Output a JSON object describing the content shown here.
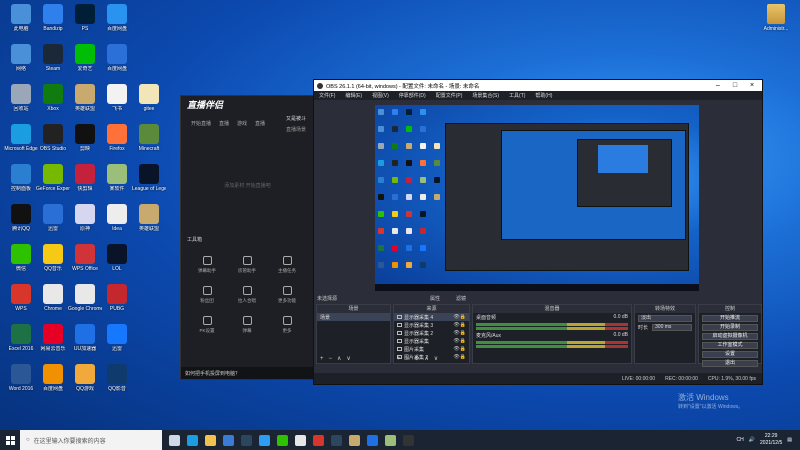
{
  "desktop": {
    "icons": [
      {
        "label": "此电脑",
        "color": "#4a90d9",
        "col": 0,
        "row": 0
      },
      {
        "label": "网络",
        "color": "#4a90d9",
        "col": 0,
        "row": 1
      },
      {
        "label": "回收站",
        "color": "#9aa7b8",
        "col": 0,
        "row": 2
      },
      {
        "label": "Microsoft Edge",
        "color": "#1b9de2",
        "col": 0,
        "row": 3
      },
      {
        "label": "控制面板",
        "color": "#2a7fd1",
        "col": 0,
        "row": 4
      },
      {
        "label": "腾讯QQ",
        "color": "#111111",
        "col": 0,
        "row": 5
      },
      {
        "label": "微信",
        "color": "#2dc100",
        "col": 0,
        "row": 6
      },
      {
        "label": "WPS",
        "color": "#d9362b",
        "col": 0,
        "row": 7
      },
      {
        "label": "Excel 2016",
        "color": "#1e7145",
        "col": 0,
        "row": 8
      },
      {
        "label": "Word 2016",
        "color": "#2b5797",
        "col": 0,
        "row": 9
      },
      {
        "label": "Bandizip",
        "color": "#2f80ed",
        "col": 1,
        "row": 0
      },
      {
        "label": "Steam",
        "color": "#1b2838",
        "col": 1,
        "row": 1
      },
      {
        "label": "Xbox",
        "color": "#107c10",
        "col": 1,
        "row": 2
      },
      {
        "label": "OBS Studio",
        "color": "#222222",
        "col": 1,
        "row": 3
      },
      {
        "label": "GeForce Experience",
        "color": "#76b900",
        "col": 1,
        "row": 4
      },
      {
        "label": "迅雷",
        "color": "#2a6fd6",
        "col": 1,
        "row": 5
      },
      {
        "label": "QQ音乐",
        "color": "#f6c915",
        "col": 1,
        "row": 6
      },
      {
        "label": "Chrome",
        "color": "#e8e8e8",
        "col": 1,
        "row": 7
      },
      {
        "label": "网易云音乐",
        "color": "#e60026",
        "col": 1,
        "row": 8
      },
      {
        "label": "百度网盘",
        "color": "#f29100",
        "col": 1,
        "row": 9
      },
      {
        "label": "PS",
        "color": "#001e36",
        "col": 2,
        "row": 0
      },
      {
        "label": "爱奇艺",
        "color": "#00be06",
        "col": 2,
        "row": 1
      },
      {
        "label": "英雄联盟",
        "color": "#c8aa6e",
        "col": 2,
        "row": 2
      },
      {
        "label": "剪映",
        "color": "#111111",
        "col": 2,
        "row": 3
      },
      {
        "label": "快剪辑",
        "color": "#c4213c",
        "col": 2,
        "row": 4
      },
      {
        "label": "原神",
        "color": "#d6d6f0",
        "col": 2,
        "row": 5
      },
      {
        "label": "WPS Office",
        "color": "#d13438",
        "col": 2,
        "row": 6
      },
      {
        "label": "Google Chrome",
        "color": "#e8e8e8",
        "col": 2,
        "row": 7
      },
      {
        "label": "UU加速器",
        "color": "#1f6fe5",
        "col": 2,
        "row": 8
      },
      {
        "label": "QQ游戏",
        "color": "#f2a93b",
        "col": 2,
        "row": 9
      },
      {
        "label": "百度网盘",
        "color": "#2a93f0",
        "col": 3,
        "row": 0
      },
      {
        "label": "百度网盘",
        "color": "#2b6fd8",
        "col": 3,
        "row": 1
      },
      {
        "label": "飞书",
        "color": "#f2f2f2",
        "col": 3,
        "row": 2
      },
      {
        "label": "Firefox",
        "color": "#ff7139",
        "col": 3,
        "row": 3
      },
      {
        "label": "某软件",
        "color": "#9bbf7b",
        "col": 3,
        "row": 4
      },
      {
        "label": "Idea",
        "color": "#ededed",
        "col": 3,
        "row": 5
      },
      {
        "label": "LOL",
        "color": "#0a1428",
        "col": 3,
        "row": 6
      },
      {
        "label": "PUBG",
        "color": "#c4272e",
        "col": 3,
        "row": 7
      },
      {
        "label": "迅雷",
        "color": "#1677ff",
        "col": 3,
        "row": 8
      },
      {
        "label": "QQ影音",
        "color": "#0e3a6e",
        "col": 3,
        "row": 9
      },
      {
        "label": "gitee",
        "color": "#f2e6b8",
        "col": 4,
        "row": 2
      },
      {
        "label": "Minecraft",
        "color": "#5a8a3a",
        "col": 4,
        "row": 3
      },
      {
        "label": "League of Legends",
        "color": "#0a1428",
        "col": 4,
        "row": 4
      },
      {
        "label": "英雄联盟",
        "color": "#c8aa6e",
        "col": 4,
        "row": 5
      }
    ],
    "admin_label": "Administr..."
  },
  "zhibo": {
    "logo": "直播伴侣",
    "tabs": [
      "开始直播",
      "直播",
      "游戏",
      "直播"
    ],
    "hint": "添加素材 开始直播吧",
    "tools_label": "工具箱",
    "tools": [
      "弹幕助手",
      "房管助手",
      "主播任务",
      "粉丝团",
      "拉人合唱",
      "更多功能",
      "PK设置",
      "弹幕",
      "更多"
    ],
    "footer": "如何把手机投屏到电脑？",
    "side_text": "又是被斗",
    "side_sub": "直播场景"
  },
  "obs": {
    "title": "OBS 26.1.1 (64-bit, windows) - 配置文件: 未命名 - 场景: 未命名",
    "menu": [
      "文件(F)",
      "编辑(E)",
      "视图(V)",
      "停靠部件(D)",
      "配置文件(P)",
      "场景集合(S)",
      "工具(T)",
      "帮助(H)"
    ],
    "no_source": "未选择源",
    "props": "属性",
    "filters": "滤镜",
    "docks": {
      "scenes": {
        "title": "场景",
        "items": [
          "场景"
        ]
      },
      "sources": {
        "title": "来源",
        "items": [
          "显示器采集 4",
          "显示器采集 3",
          "显示器采集 2",
          "显示器采集",
          "图片采集",
          "图片采集 2"
        ]
      },
      "mixer": {
        "title": "混音器",
        "tracks": [
          {
            "name": "桌面音频",
            "db": "0.0 dB"
          },
          {
            "name": "麦克风/Aux",
            "db": "0.0 dB"
          }
        ]
      },
      "transitions": {
        "title": "转场特效",
        "type": "淡出",
        "duration_label": "时长",
        "duration": "300 ms"
      },
      "controls": {
        "title": "控制",
        "buttons": [
          "开始推流",
          "开始录制",
          "启动虚拟摄像机",
          "工作室模式",
          "设置",
          "退出"
        ]
      }
    },
    "status": {
      "live": "LIVE: 00:00:00",
      "rec": "REC: 00:00:00",
      "cpu": "CPU: 1.9%, 30.00 fps"
    }
  },
  "watermark": {
    "line1": "激活 Windows",
    "line2": "转到\"设置\"以激活 Windows。"
  },
  "taskbar": {
    "search_placeholder": "在这里输入你要搜索的内容",
    "apps": [
      {
        "name": "task-view",
        "color": "#cfd8e6"
      },
      {
        "name": "edge",
        "color": "#1b9de2"
      },
      {
        "name": "explorer",
        "color": "#f2c14e"
      },
      {
        "name": "store",
        "color": "#3a7bd5"
      },
      {
        "name": "steam",
        "color": "#2a475e"
      },
      {
        "name": "qq",
        "color": "#2f9cf4"
      },
      {
        "name": "wechat",
        "color": "#2dc100"
      },
      {
        "name": "chrome",
        "color": "#e6e6e6"
      },
      {
        "name": "wps",
        "color": "#d9362b"
      },
      {
        "name": "steam2",
        "color": "#2a475e"
      },
      {
        "name": "app",
        "color": "#c8aa6e"
      },
      {
        "name": "app2",
        "color": "#1f6fe5"
      },
      {
        "name": "app3",
        "color": "#9bbf7b"
      },
      {
        "name": "obs",
        "color": "#333333"
      }
    ],
    "tray_text": "CH",
    "time": "22:29",
    "date": "2021/12/5"
  }
}
